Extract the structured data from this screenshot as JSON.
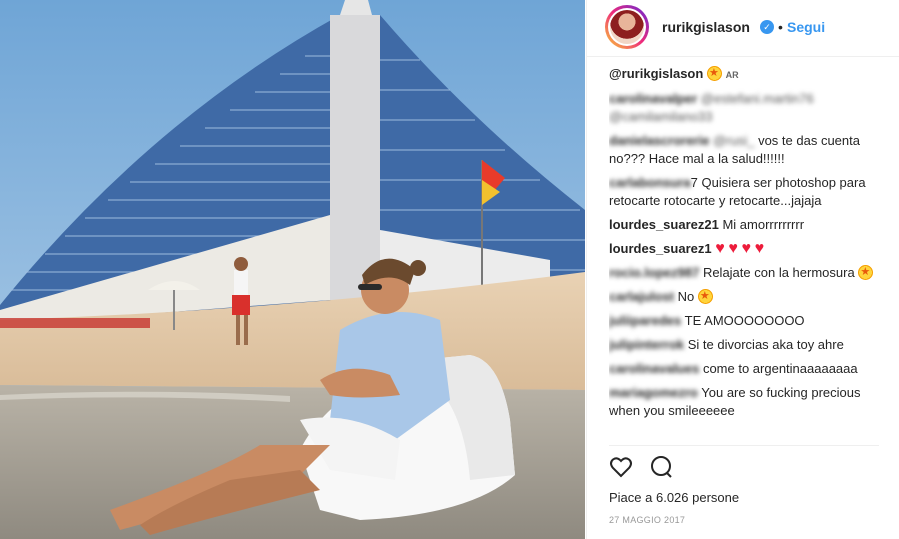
{
  "post": {
    "username": "rurikgislason",
    "verified_glyph": "✓",
    "separator": "•",
    "follow_label": "Segui",
    "photo": {
      "description_icon": "beach-photo"
    }
  },
  "comments": [
    {
      "user": "@rurikgislason",
      "text": "",
      "blurred": false,
      "tail": "AR"
    },
    {
      "user": "carolinavalper",
      "text": "@estefani.martin76 @camilamilano33",
      "blurred": true
    },
    {
      "user": "danielascrorerie",
      "user_tail": "@rusi_",
      "text": "vos te das cuenta no??? Hace mal a la salud!!!!!!",
      "blurred": false
    },
    {
      "user": "carlabonsura",
      "user_tail": "7",
      "text": "Quisiera ser photoshop para retocarte rotocarte y retocarte...jajaja",
      "blurred": false
    },
    {
      "user": "lourdes_suarez21",
      "text": "Mi amorrrrrrrrr",
      "blurred": false
    },
    {
      "user": "lourdes_suarez1",
      "text": "",
      "hearts": 4
    },
    {
      "user": "rocio.lopez987",
      "text": "Relajate con la hermosura",
      "blurred": false
    },
    {
      "user": "carlajulost",
      "text": "No",
      "blurred": false
    },
    {
      "user": "juliiparedes",
      "text": "TE AMOOOOOOOO",
      "blurred": false
    },
    {
      "user": "julipinterrok",
      "text": "Si te divorcias aka toy ahre",
      "blurred": false
    },
    {
      "user": "carolinavalues",
      "text": "come to argentinaaaaaaaa",
      "blurred": false
    },
    {
      "user": "mariagomezro",
      "text": "You are so fucking precious when you smileeeeee",
      "blurred": false
    }
  ],
  "actions": {
    "like_icon": "heart-outline-icon",
    "comment_icon": "comment-bubble-icon"
  },
  "likes_text": "Piace a 6.026 persone",
  "date_text": "27 MAGGIO 2017",
  "colors": {
    "accent": "#3897f0",
    "text": "#262626",
    "muted": "#999999",
    "heart": "#ed1c3b"
  }
}
